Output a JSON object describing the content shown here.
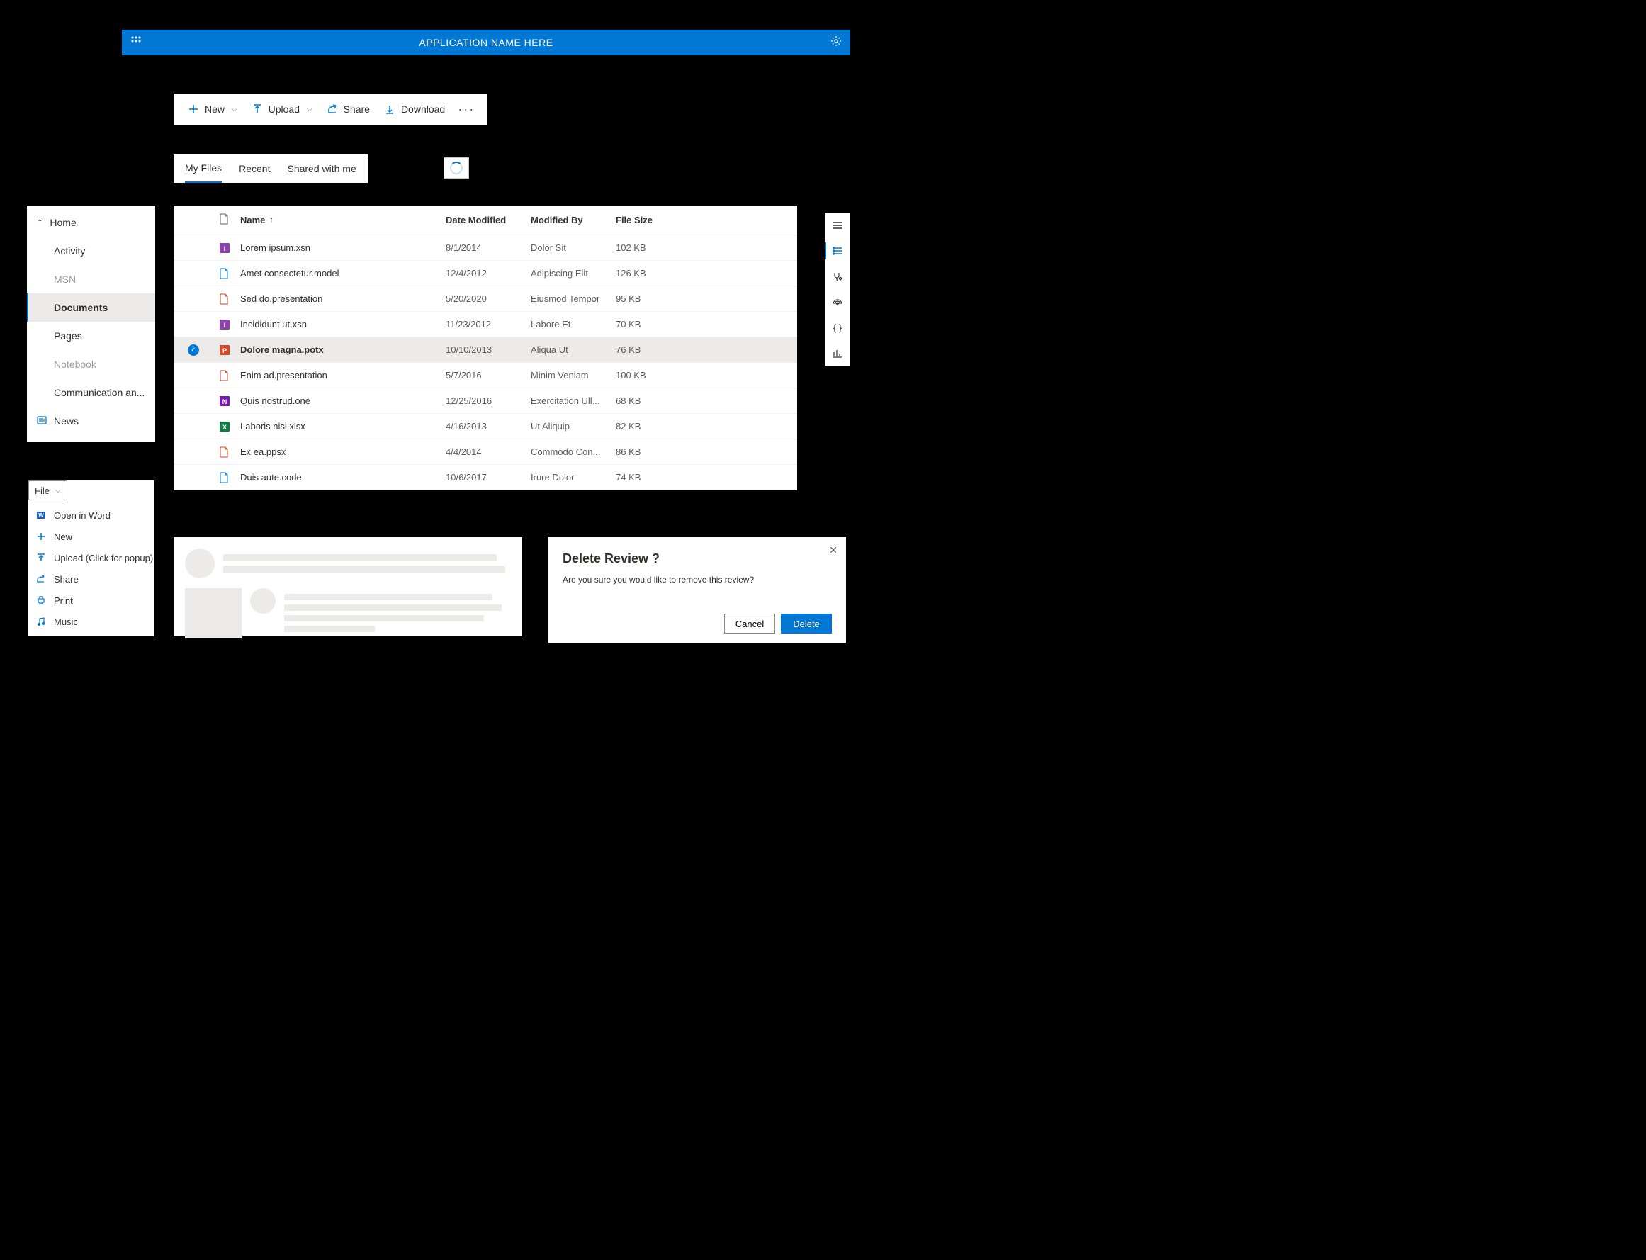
{
  "topbar": {
    "title": "APPLICATION NAME HERE"
  },
  "cmdbar": {
    "new": "New",
    "upload": "Upload",
    "share": "Share",
    "download": "Download"
  },
  "tabs": {
    "my_files": "My Files",
    "recent": "Recent",
    "shared": "Shared with me"
  },
  "sidenav": {
    "home": "Home",
    "activity": "Activity",
    "msn": "MSN",
    "documents": "Documents",
    "pages": "Pages",
    "notebook": "Notebook",
    "communication": "Communication an...",
    "news": "News"
  },
  "table": {
    "headers": {
      "name": "Name",
      "date_modified": "Date Modified",
      "modified_by": "Modified By",
      "file_size": "File Size"
    },
    "rows": [
      {
        "icon": "infopath",
        "name": "Lorem ipsum.xsn",
        "date": "8/1/2014",
        "by": "Dolor Sit",
        "size": "102 KB",
        "selected": false
      },
      {
        "icon": "model",
        "name": "Amet consectetur.model",
        "date": "12/4/2012",
        "by": "Adipiscing Elit",
        "size": "126 KB",
        "selected": false
      },
      {
        "icon": "presentation",
        "name": "Sed do.presentation",
        "date": "5/20/2020",
        "by": "Eiusmod Tempor",
        "size": "95 KB",
        "selected": false
      },
      {
        "icon": "infopath",
        "name": "Incididunt ut.xsn",
        "date": "11/23/2012",
        "by": "Labore Et",
        "size": "70 KB",
        "selected": false
      },
      {
        "icon": "powerpoint",
        "name": "Dolore magna.potx",
        "date": "10/10/2013",
        "by": "Aliqua Ut",
        "size": "76 KB",
        "selected": true
      },
      {
        "icon": "presentation",
        "name": "Enim ad.presentation",
        "date": "5/7/2016",
        "by": "Minim Veniam",
        "size": "100 KB",
        "selected": false
      },
      {
        "icon": "onenote",
        "name": "Quis nostrud.one",
        "date": "12/25/2016",
        "by": "Exercitation Ull...",
        "size": "68 KB",
        "selected": false
      },
      {
        "icon": "excel",
        "name": "Laboris nisi.xlsx",
        "date": "4/16/2013",
        "by": "Ut Aliquip",
        "size": "82 KB",
        "selected": false
      },
      {
        "icon": "ppsx",
        "name": "Ex ea.ppsx",
        "date": "4/4/2014",
        "by": "Commodo Con...",
        "size": "86 KB",
        "selected": false
      },
      {
        "icon": "code",
        "name": "Duis aute.code",
        "date": "10/6/2017",
        "by": "Irure Dolor",
        "size": "74 KB",
        "selected": false
      }
    ]
  },
  "filemenu": {
    "button": "File",
    "items": {
      "open_word": "Open in Word",
      "new": "New",
      "upload": "Upload (Click for popup)",
      "share": "Share",
      "print": "Print",
      "music": "Music"
    }
  },
  "dialog": {
    "title": "Delete Review ?",
    "body": "Are you sure you would like to remove this review?",
    "cancel": "Cancel",
    "delete": "Delete"
  }
}
